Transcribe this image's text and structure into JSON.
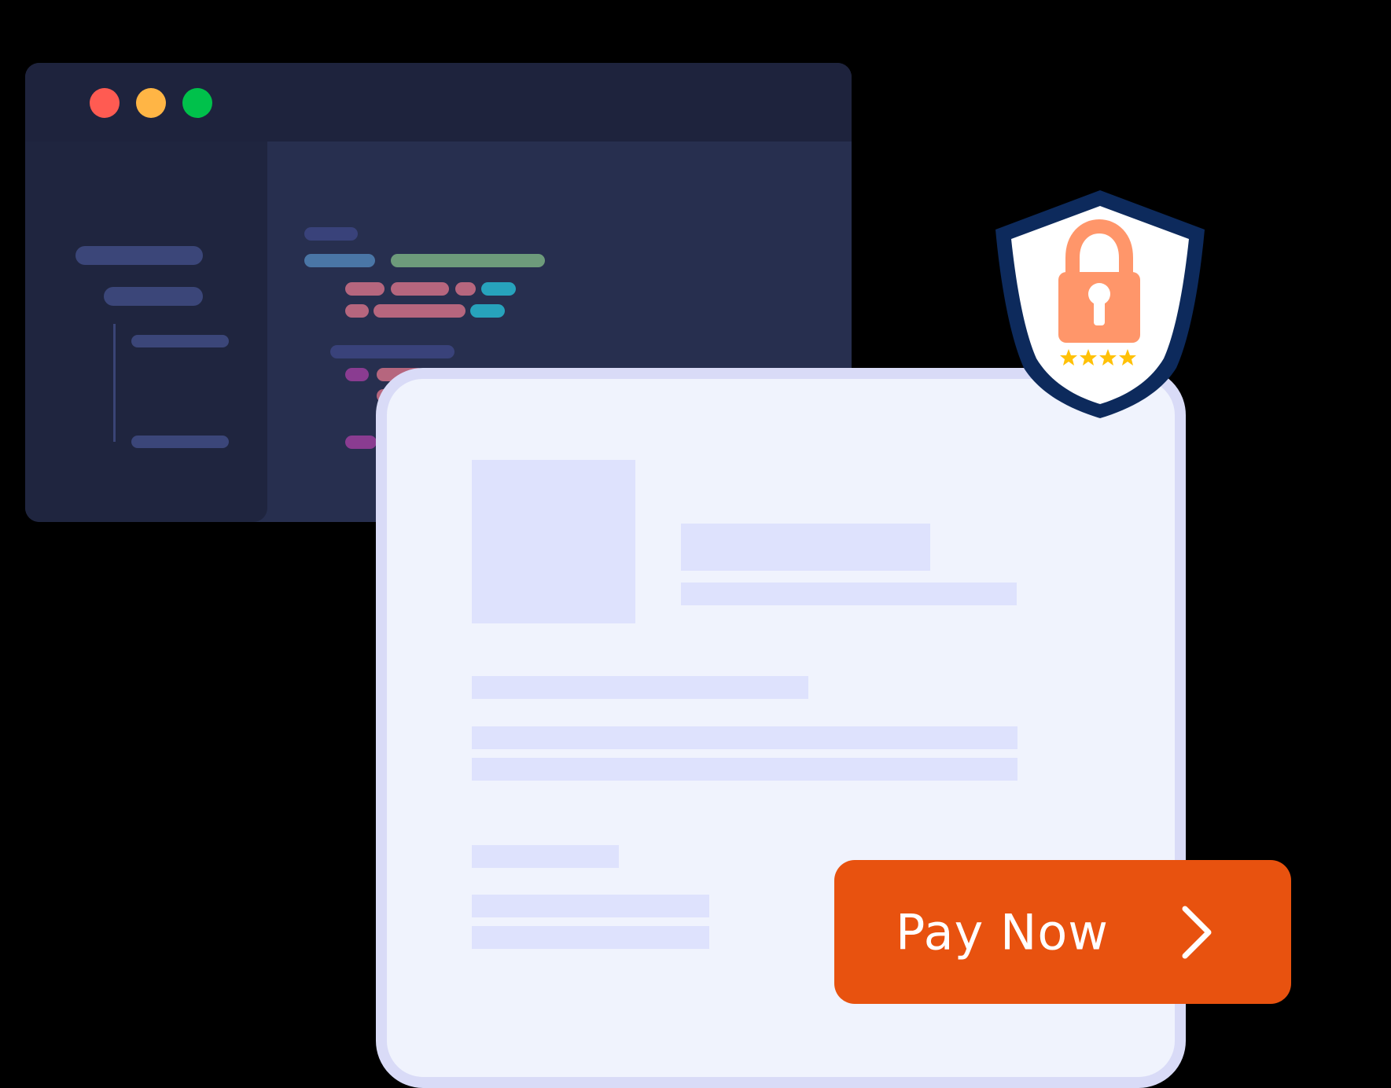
{
  "editor": {
    "window_controls": [
      "close",
      "minimize",
      "maximize"
    ],
    "colors": {
      "close": "#ff5b52",
      "minimize": "#ffb545",
      "maximize": "#00c14b",
      "titlebar": "#1e233d",
      "body": "#272f4f",
      "sidebar": "#1f253f"
    }
  },
  "checkout": {
    "pay_button": {
      "label": "Pay Now",
      "icon": "chevron-right-icon",
      "color": "#e8520f"
    }
  },
  "security_badge": {
    "icon": "shield-lock-icon",
    "rating_stars": 4,
    "colors": {
      "shield_border": "#0d2a5c",
      "lock": "#ff966a",
      "stars": "#ffc107"
    }
  }
}
